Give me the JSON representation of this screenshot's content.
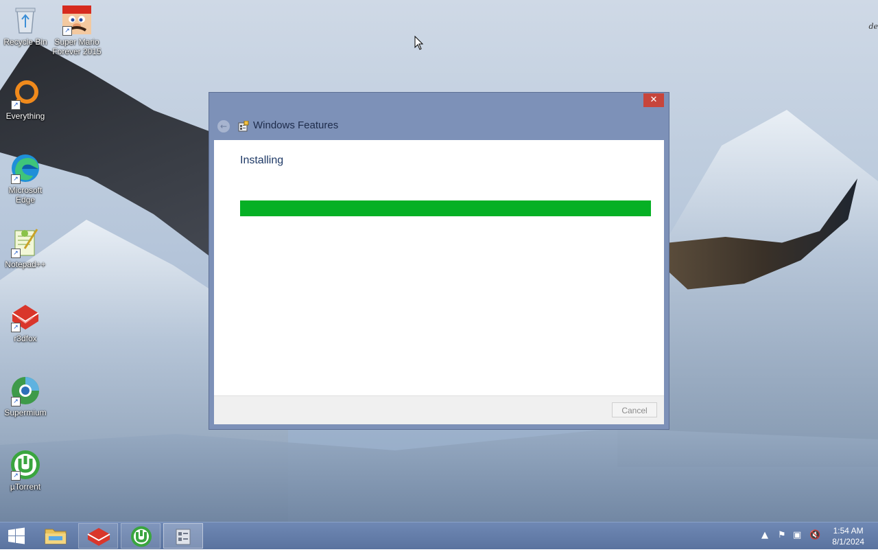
{
  "desktop": {
    "icons": [
      {
        "label": "Recycle Bin",
        "icon": "recycle-bin-icon"
      },
      {
        "label": "Super Mario Forever 2015",
        "icon": "mario-icon"
      },
      {
        "label": "Everything",
        "icon": "everything-icon"
      },
      {
        "label": "Microsoft Edge",
        "icon": "edge-icon"
      },
      {
        "label": "Notepad++",
        "icon": "notepadpp-icon"
      },
      {
        "label": "r3dfox",
        "icon": "r3dfox-icon"
      },
      {
        "label": "Supermium",
        "icon": "supermium-icon"
      },
      {
        "label": "µTorrent",
        "icon": "utorrent-icon"
      }
    ],
    "corner_text": "de"
  },
  "dialog": {
    "title": "Windows Features",
    "status": "Installing",
    "progress_percent": 100,
    "cancel_label": "Cancel",
    "close_glyph": "✕"
  },
  "taskbar": {
    "pinned": [
      {
        "name": "file-explorer",
        "icon": "folder-icon",
        "state": "idle"
      },
      {
        "name": "r3dfox",
        "icon": "r3dfox-icon",
        "state": "running"
      },
      {
        "name": "utorrent",
        "icon": "utorrent-icon",
        "state": "running"
      },
      {
        "name": "windows-features",
        "icon": "windows-features-icon",
        "state": "active"
      }
    ],
    "clock": {
      "time": "1:54 AM",
      "date": "8/1/2024"
    }
  },
  "colors": {
    "progress": "#06b025",
    "close": "#c7453b",
    "dialog_frame": "#7d91b8",
    "taskbar": "#5a739f"
  }
}
